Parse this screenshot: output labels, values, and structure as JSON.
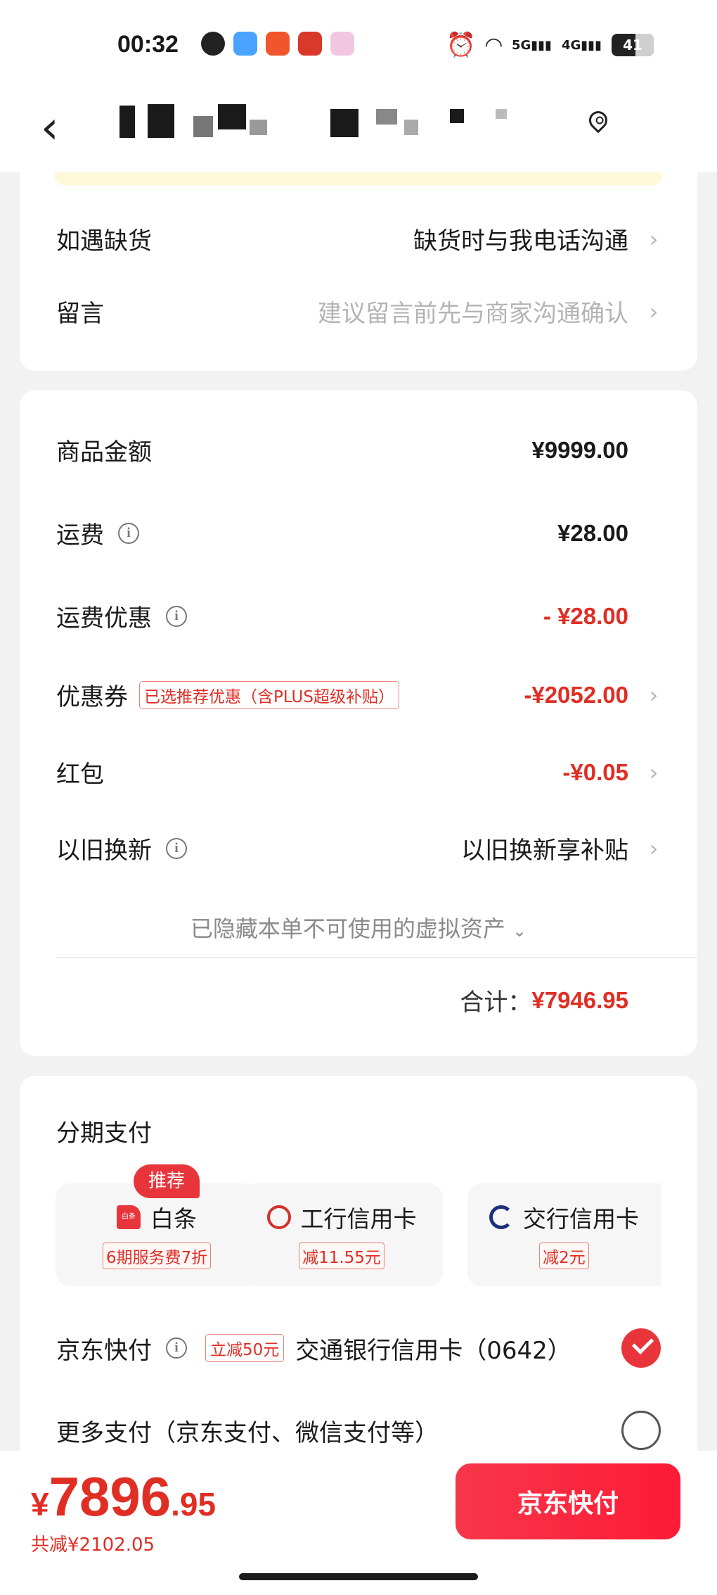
{
  "status_bar": {
    "time": "00:32",
    "battery": "41",
    "network_5g": "5G",
    "network_4g": "4G"
  },
  "header": {
    "back_icon": "chevron-left-icon",
    "location_icon": "location-pin-icon"
  },
  "order_options": {
    "out_of_stock": {
      "label": "如遇缺货",
      "value": "缺货时与我电话沟通"
    },
    "message": {
      "label": "留言",
      "placeholder": "建议留言前先与商家沟通确认"
    }
  },
  "price_summary": {
    "goods_amount": {
      "label": "商品金额",
      "value": "¥9999.00"
    },
    "shipping": {
      "label": "运费",
      "value": "¥28.00"
    },
    "shipping_discount": {
      "label": "运费优惠",
      "value": "- ¥28.00"
    },
    "coupon": {
      "label": "优惠券",
      "tag": "已选推荐优惠（含PLUS超级补贴）",
      "value": "-¥2052.00"
    },
    "red_packet": {
      "label": "红包",
      "value": "-¥0.05"
    },
    "trade_in": {
      "label": "以旧换新",
      "value": "以旧换新享补贴"
    },
    "hidden_note": "已隐藏本单不可使用的虚拟资产",
    "total_label": "合计：",
    "total_value": "¥7946.95"
  },
  "payment": {
    "installment_title": "分期支付",
    "recommend_badge": "推荐",
    "installment_options": [
      {
        "name": "白条",
        "promo": "6期服务费7折",
        "logo_text": "白条"
      },
      {
        "name": "工行信用卡",
        "promo": "减11.55元"
      },
      {
        "name": "交行信用卡",
        "promo": "减2元"
      }
    ],
    "jd_quickpay": {
      "label": "京东快付",
      "tag": "立减50元",
      "card": "交通银行信用卡（0642）",
      "selected": true
    },
    "more_pay": {
      "label": "更多支付（京东支付、微信支付等）",
      "selected": false
    }
  },
  "bottom_bar": {
    "currency": "¥",
    "price_int": "7896",
    "price_dec": ".95",
    "saved": "共减¥2102.05",
    "pay_button": "京东快付"
  },
  "colors": {
    "accent_red": "#e02e24",
    "button_red": "#f8364a"
  }
}
